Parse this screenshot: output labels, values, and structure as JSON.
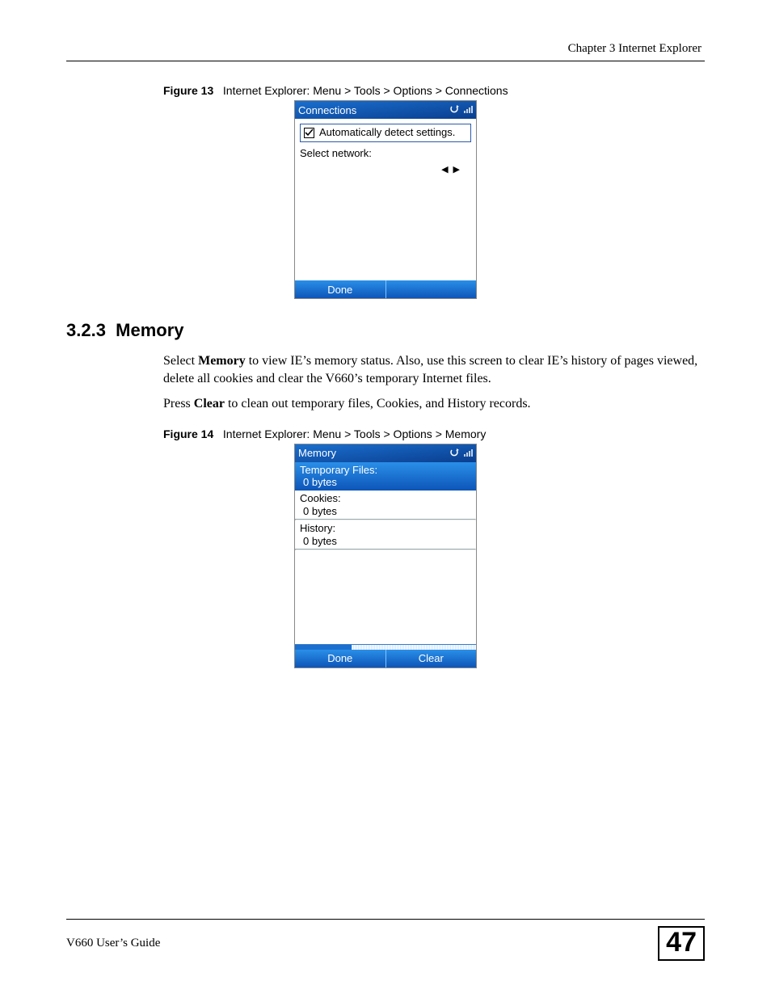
{
  "header": {
    "chapter_label": "Chapter 3 Internet Explorer"
  },
  "figure13": {
    "label": "Figure 13",
    "caption": "Internet Explorer: Menu > Tools > Options > Connections",
    "phone": {
      "title": "Connections",
      "checkbox_label": "Automatically detect settings.",
      "checkbox_checked": true,
      "select_label": "Select network:",
      "softkey_left": "Done",
      "softkey_right": ""
    }
  },
  "section": {
    "number": "3.2.3",
    "title": "Memory",
    "para1_pre": "Select ",
    "para1_bold": "Memory",
    "para1_post": " to view IE’s memory status. Also, use this screen to clear IE’s history of pages viewed, delete all cookies and clear the V660’s temporary Internet files.",
    "para2_pre": "Press ",
    "para2_bold": "Clear",
    "para2_post": " to clean out temporary files, Cookies, and History records."
  },
  "figure14": {
    "label": "Figure 14",
    "caption": "Internet Explorer: Menu > Tools > Options > Memory",
    "phone": {
      "title": "Memory",
      "items": [
        {
          "label": "Temporary Files:",
          "value": "0 bytes",
          "selected": true
        },
        {
          "label": "Cookies:",
          "value": "0 bytes",
          "selected": false
        },
        {
          "label": "History:",
          "value": "0 bytes",
          "selected": false
        }
      ],
      "softkey_left": "Done",
      "softkey_right": "Clear"
    }
  },
  "footer": {
    "guide": "V660 User’s Guide",
    "page_number": "47"
  }
}
